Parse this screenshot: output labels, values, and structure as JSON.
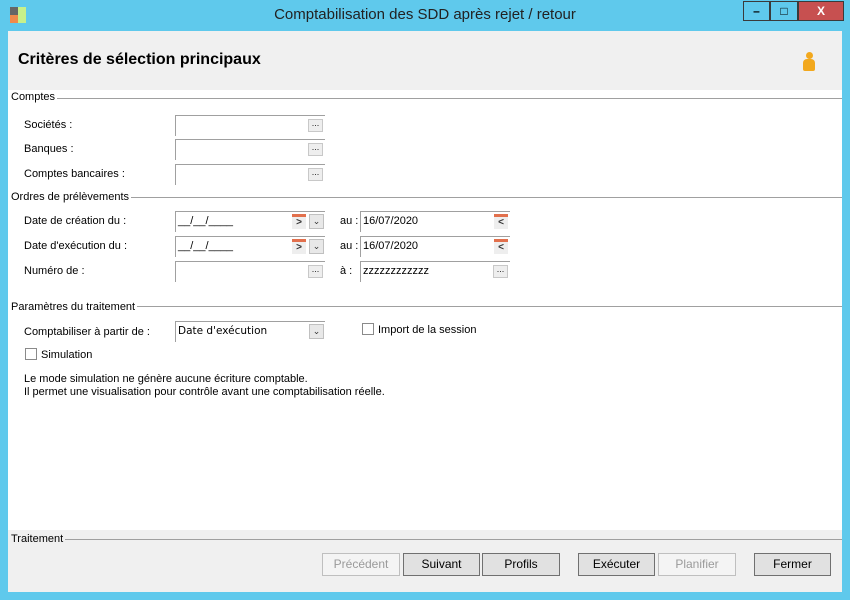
{
  "window": {
    "title": "Comptabilisation des SDD après rejet / retour",
    "minimize": "–",
    "maximize": "□",
    "close": "X"
  },
  "header": {
    "title": "Critères de sélection principaux"
  },
  "comptes": {
    "section": "Comptes",
    "societes": "Sociétés :",
    "banques": "Banques :",
    "comptes_bancaires": "Comptes bancaires :",
    "ellipsis": "..."
  },
  "ordres": {
    "section": "Ordres de prélèvements",
    "date_creation": "Date de création du :",
    "date_execution": "Date d'exécution du :",
    "numero": "Numéro de :",
    "au": "au :",
    "a": "à :",
    "creation_from": "__/__/____",
    "creation_to": "16/07/2020",
    "execution_from": "__/__/____",
    "execution_to": "16/07/2020",
    "numero_from": "",
    "numero_to": "zzzzzzzzzzzz"
  },
  "parametres": {
    "section": "Paramètres du traitement",
    "comptabiliser_label": "Comptabiliser à partir de :",
    "comptabiliser_value": "Date d'exécution",
    "import_session": "Import de la session",
    "import_checked": false,
    "simulation": "Simulation",
    "simulation_checked": false,
    "info_line1": "Le mode simulation ne génère aucune écriture comptable.",
    "info_line2": "Il permet une visualisation pour contrôle avant une comptabilisation réelle."
  },
  "traitement": {
    "section": "Traitement",
    "precedent": "Précédent",
    "suivant": "Suivant",
    "profils": "Profils",
    "executer": "Exécuter",
    "planifier": "Planifier",
    "fermer": "Fermer"
  }
}
